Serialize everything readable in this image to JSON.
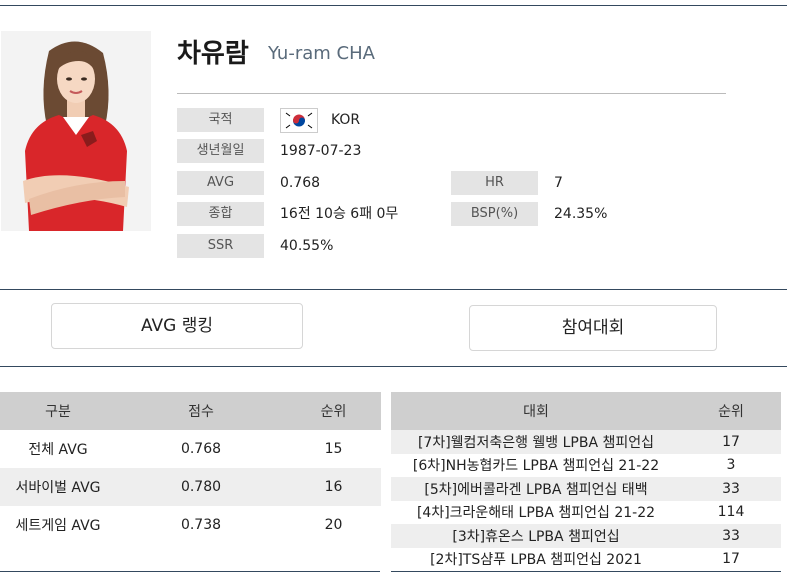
{
  "player": {
    "name_kr": "차유람",
    "name_en": "Yu-ram CHA",
    "jersey_text": "웰컴저축은행"
  },
  "info": {
    "nationality_label": "국적",
    "nationality_value": "KOR",
    "birth_label": "생년월일",
    "birth_value": "1987-07-23",
    "avg_label": "AVG",
    "avg_value": "0.768",
    "hr_label": "HR",
    "hr_value": "7",
    "record_label": "종합",
    "record_value": "16전 10승 6패 0무",
    "bsp_label": "BSP(%)",
    "bsp_value": "24.35%",
    "ssr_label": "SSR",
    "ssr_value": "40.55%"
  },
  "buttons": {
    "avg_ranking": "AVG 랭킹",
    "tournaments": "참여대회"
  },
  "stats_table": {
    "headers": [
      "구분",
      "점수",
      "순위"
    ],
    "rows": [
      [
        "전체 AVG",
        "0.768",
        "15"
      ],
      [
        "서바이벌 AVG",
        "0.780",
        "16"
      ],
      [
        "세트게임 AVG",
        "0.738",
        "20"
      ]
    ]
  },
  "tournament_table": {
    "headers": [
      "대회",
      "순위"
    ],
    "rows": [
      [
        "[7차]웰컴저축은행 웰뱅 LPBA 챔피언십",
        "17"
      ],
      [
        "[6차]NH농협카드 LPBA 챔피언십 21-22",
        "3"
      ],
      [
        "[5차]에버콜라겐 LPBA 챔피언십 태백",
        "33"
      ],
      [
        "[4차]크라운해태 LPBA 챔피언십 21-22",
        "114"
      ],
      [
        "[3차]휴온스 LPBA 챔피언십",
        "33"
      ],
      [
        "[2차]TS샴푸 LPBA 챔피언십 2021",
        "17"
      ]
    ]
  },
  "colors": {
    "rule": "#34495e",
    "label_bg": "#e4e4e4",
    "table_header_bg": "#cfcfcf",
    "jersey_red": "#d9262a"
  }
}
